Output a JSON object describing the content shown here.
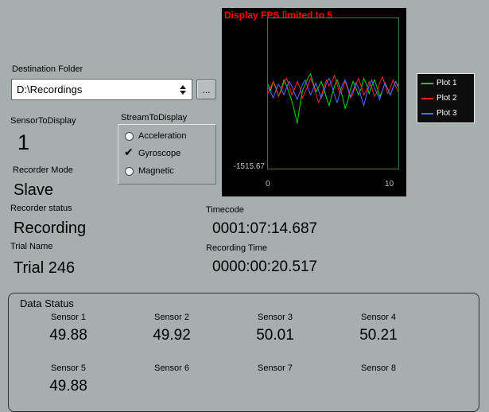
{
  "destination": {
    "label": "Destination Folder",
    "value": "D:\\Recordings",
    "browse_label": "..."
  },
  "sensor_to_display": {
    "label": "SensorToDisplay",
    "value": "1"
  },
  "stream_to_display": {
    "label": "StreamToDisplay",
    "options": [
      {
        "label": "Acceleration",
        "selected": false
      },
      {
        "label": "Gyroscope",
        "selected": true
      },
      {
        "label": "Magnetic",
        "selected": false
      }
    ]
  },
  "recorder_mode": {
    "label": "Recorder Mode",
    "value": "Slave"
  },
  "recorder_status": {
    "label": "Recorder status",
    "value": "Recording"
  },
  "trial": {
    "label": "Trial Name",
    "value": "Trial 246"
  },
  "timecode": {
    "label": "Timecode",
    "value": "0001:07:14.687"
  },
  "recording_time": {
    "label": "Recording Time",
    "value": "0000:00:20.517"
  },
  "chart": {
    "warning": "Display FPS limited to 5",
    "y_min_label": "-1515.67",
    "x_ticks": [
      "0",
      "10"
    ]
  },
  "chart_data": {
    "type": "line",
    "x_range": [
      0,
      10
    ],
    "y_tick_labels": [
      "-1515.67"
    ],
    "legend_position": "right",
    "series": [
      {
        "name": "Plot 1",
        "color": "#00dd00",
        "values": [
          0.44,
          0.48,
          0.42,
          0.46,
          0.52,
          0.47,
          0.41,
          0.45,
          0.5,
          0.55,
          0.62,
          0.7,
          0.58,
          0.48,
          0.44,
          0.4,
          0.37,
          0.43,
          0.49,
          0.46,
          0.42,
          0.47,
          0.53,
          0.58,
          0.51,
          0.45,
          0.41,
          0.46,
          0.52,
          0.6,
          0.55,
          0.47,
          0.42,
          0.46,
          0.51,
          0.47,
          0.4,
          0.44,
          0.5,
          0.45,
          0.41,
          0.46,
          0.52,
          0.48,
          0.43,
          0.47,
          0.51,
          0.46,
          0.42,
          0.45
        ]
      },
      {
        "name": "Plot 2",
        "color": "#ff2222",
        "values": [
          0.5,
          0.46,
          0.42,
          0.47,
          0.52,
          0.48,
          0.43,
          0.4,
          0.45,
          0.51,
          0.47,
          0.42,
          0.46,
          0.53,
          0.49,
          0.45,
          0.4,
          0.44,
          0.5,
          0.56,
          0.52,
          0.46,
          0.41,
          0.45,
          0.42,
          0.38,
          0.44,
          0.5,
          0.47,
          0.42,
          0.47,
          0.53,
          0.5,
          0.44,
          0.4,
          0.45,
          0.51,
          0.48,
          0.42,
          0.46,
          0.52,
          0.49,
          0.43,
          0.39,
          0.44,
          0.5,
          0.46,
          0.41,
          0.45,
          0.49
        ]
      },
      {
        "name": "Plot 3",
        "color": "#5566ff",
        "values": [
          0.46,
          0.49,
          0.53,
          0.48,
          0.44,
          0.47,
          0.51,
          0.46,
          0.42,
          0.45,
          0.5,
          0.54,
          0.49,
          0.44,
          0.41,
          0.46,
          0.51,
          0.47,
          0.43,
          0.48,
          0.53,
          0.49,
          0.43,
          0.4,
          0.45,
          0.51,
          0.56,
          0.5,
          0.44,
          0.41,
          0.46,
          0.52,
          0.48,
          0.43,
          0.46,
          0.52,
          0.58,
          0.51,
          0.45,
          0.41,
          0.46,
          0.5,
          0.54,
          0.48,
          0.43,
          0.47,
          0.51,
          0.46,
          0.42,
          0.46
        ]
      }
    ]
  },
  "data_status": {
    "title": "Data Status",
    "sensors": [
      {
        "label": "Sensor 1",
        "value": "49.88"
      },
      {
        "label": "Sensor 2",
        "value": "49.92"
      },
      {
        "label": "Sensor 3",
        "value": "50.01"
      },
      {
        "label": "Sensor 4",
        "value": "50.21"
      },
      {
        "label": "Sensor 5",
        "value": "49.88"
      },
      {
        "label": "Sensor 6",
        "value": ""
      },
      {
        "label": "Sensor 7",
        "value": ""
      },
      {
        "label": "Sensor 8",
        "value": ""
      }
    ]
  }
}
